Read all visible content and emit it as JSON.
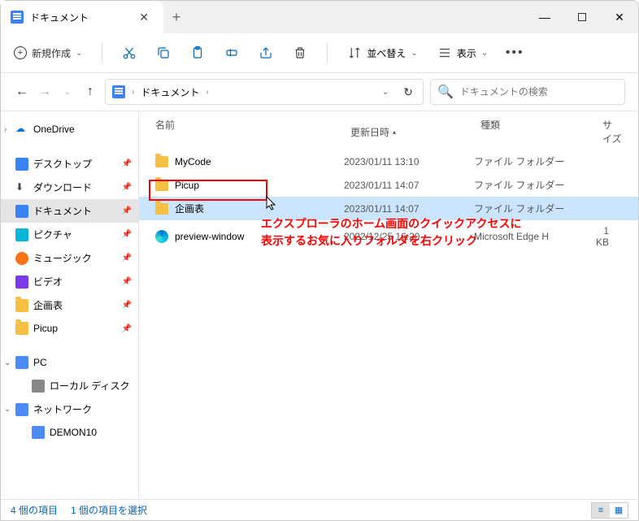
{
  "tab": {
    "title": "ドキュメント"
  },
  "toolbar": {
    "new_label": "新規作成",
    "sort_label": "並べ替え",
    "view_label": "表示"
  },
  "breadcrumb": {
    "current": "ドキュメント"
  },
  "search": {
    "placeholder": "ドキュメントの検索"
  },
  "sidebar": {
    "onedrive": "OneDrive",
    "items": [
      {
        "label": "デスクトップ"
      },
      {
        "label": "ダウンロード"
      },
      {
        "label": "ドキュメント"
      },
      {
        "label": "ピクチャ"
      },
      {
        "label": "ミュージック"
      },
      {
        "label": "ビデオ"
      },
      {
        "label": "企画表"
      },
      {
        "label": "Picup"
      }
    ],
    "pc": "PC",
    "localdisk": "ローカル ディスク",
    "network": "ネットワーク",
    "demon": "DEMON10"
  },
  "columns": {
    "name": "名前",
    "date": "更新日時",
    "type": "種類",
    "size": "サイズ"
  },
  "rows": [
    {
      "name": "MyCode",
      "date": "2023/01/11 13:10",
      "type": "ファイル フォルダー",
      "size": "",
      "kind": "folder"
    },
    {
      "name": "Picup",
      "date": "2023/01/11 14:07",
      "type": "ファイル フォルダー",
      "size": "",
      "kind": "folder"
    },
    {
      "name": "企画表",
      "date": "2023/01/11 14:07",
      "type": "ファイル フォルダー",
      "size": "",
      "kind": "folder"
    },
    {
      "name": "preview-window",
      "date": "2022/12/25 16:20",
      "type": "Microsoft Edge H",
      "size": "1 KB",
      "kind": "edge"
    }
  ],
  "annotation": {
    "line1": "エクスプローラのホーム画面のクイックアクセスに",
    "line2": "表示するお気に入りフォルダを右クリック"
  },
  "status": {
    "count": "4 個の項目",
    "selected": "1 個の項目を選択"
  }
}
